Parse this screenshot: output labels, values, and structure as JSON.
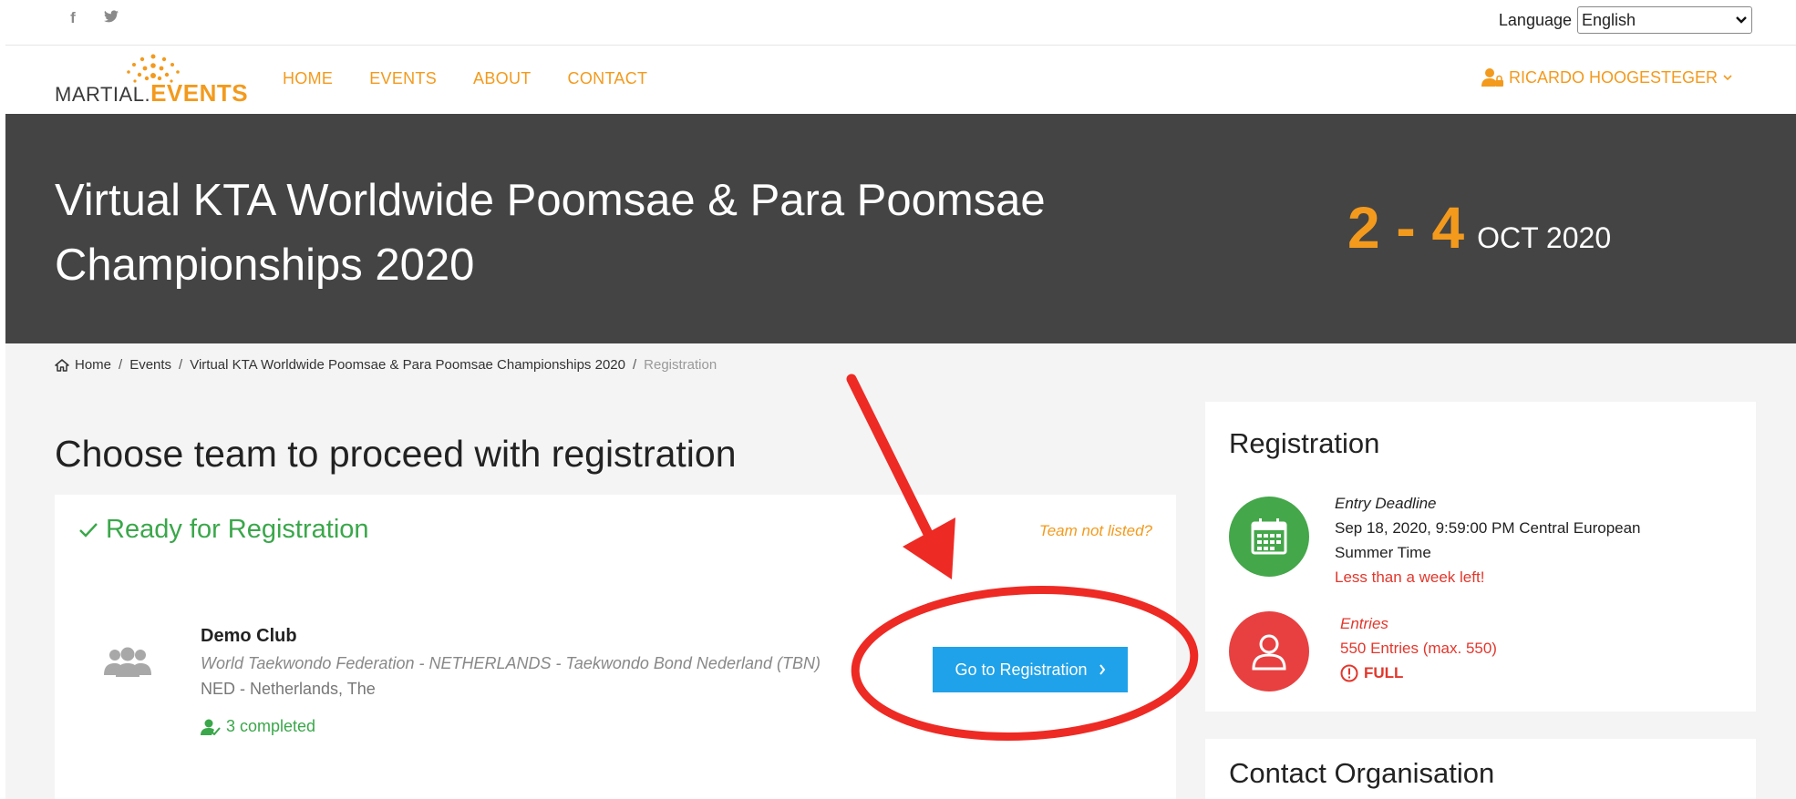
{
  "topbar": {
    "social": [
      {
        "icon": "facebook-icon",
        "glyph": "f"
      },
      {
        "icon": "twitter-icon",
        "glyph": "𝕥"
      }
    ],
    "language_label": "Language",
    "language_value": "English"
  },
  "nav": {
    "logo_left": "MARTIAL.",
    "logo_right": "EVENTS",
    "links": [
      "HOME",
      "EVENTS",
      "ABOUT",
      "CONTACT"
    ],
    "user_name": "RICARDO HOOGESTEGER"
  },
  "hero": {
    "title": "Virtual KTA Worldwide Poomsae & Para Poomsae Championships 2020",
    "days": "2 - 4",
    "month": "OCT 2020"
  },
  "breadcrumb": {
    "items": [
      "Home",
      "Events",
      "Virtual KTA Worldwide Poomsae & Para Poomsae Championships 2020"
    ],
    "current": "Registration"
  },
  "main": {
    "heading": "Choose team to proceed with registration",
    "ready_label": "Ready for Registration",
    "team_not_listed": "Team not listed?",
    "club": {
      "name": "Demo Club",
      "federation": "World Taekwondo Federation - NETHERLANDS - Taekwondo Bond Nederland (TBN)",
      "country": "NED - Netherlands, The",
      "completed": "3 completed"
    },
    "go_button": "Go to Registration"
  },
  "sidebar": {
    "registration_title": "Registration",
    "deadline_label": "Entry Deadline",
    "deadline_value": "Sep 18, 2020, 9:59:00 PM Central European Summer Time",
    "deadline_warning": "Less than a week left!",
    "entries_label": "Entries",
    "entries_value": "550 Entries (max. 550)",
    "entries_status": "FULL",
    "contact_title": "Contact Organisation"
  },
  "colors": {
    "accent": "#f39a1d",
    "hero_bg": "#444444",
    "button": "#1fa2e9",
    "success": "#3aa74a",
    "danger": "#e2372c",
    "annotation": "#ee2a24"
  }
}
